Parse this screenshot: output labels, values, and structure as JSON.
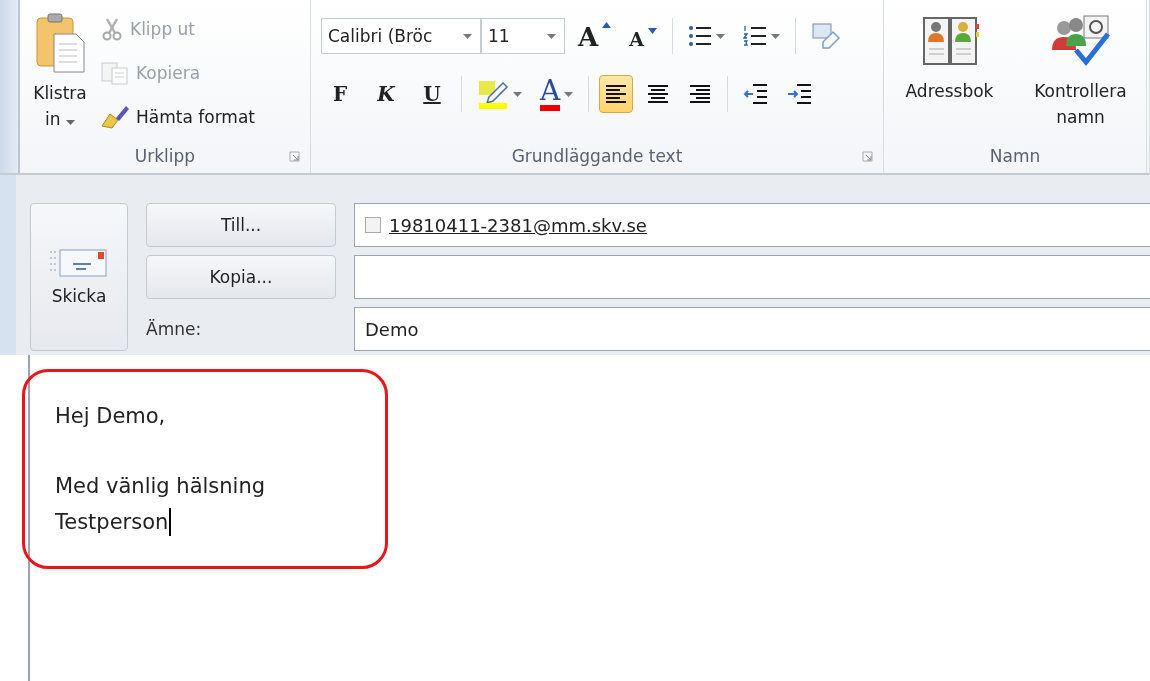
{
  "ribbon": {
    "clipboard": {
      "label": "Urklipp",
      "paste": "Klistra in",
      "small_buttons": [
        {
          "kind": "cut",
          "label": "Klipp ut",
          "disabled": true
        },
        {
          "kind": "copy",
          "label": "Kopiera",
          "disabled": true
        },
        {
          "kind": "format_painter",
          "label": "Hämta format",
          "disabled": false
        }
      ]
    },
    "basic_text": {
      "label": "Grundläggande text",
      "font_name": "Calibri (Bröc",
      "font_size": "11",
      "grow_font": "A",
      "shrink_font": "A",
      "bold": "F",
      "italic": "K",
      "underline": "U",
      "font_color": "A",
      "alignment": [
        {
          "kind": "left",
          "selected": true
        },
        {
          "kind": "center",
          "selected": false
        },
        {
          "kind": "right",
          "selected": false
        }
      ]
    },
    "names": {
      "label": "Namn",
      "buttons": [
        {
          "kind": "address_book",
          "label": "Adressbok"
        },
        {
          "kind": "check_names",
          "label": "Kontrollera namn"
        }
      ]
    }
  },
  "message": {
    "send": "Skicka",
    "to_button": "Till...",
    "cc_button": "Kopia...",
    "subject_label": "Ämne:",
    "to": [
      {
        "address": "19810411-2381@mm.skv.se",
        "checked": false
      }
    ],
    "subject": "Demo",
    "body": [
      [
        "Hej Demo,"
      ],
      [
        "Med vänlig hälsning",
        "Testperson"
      ]
    ],
    "highlighted": true
  }
}
